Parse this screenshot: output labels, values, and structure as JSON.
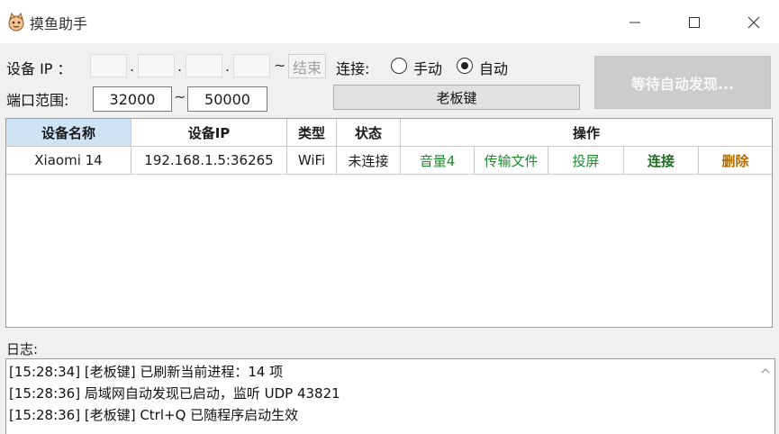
{
  "window": {
    "title": "摸鱼助手"
  },
  "controls": {
    "device_ip_label": "设备 IP ：",
    "ip_dots": [
      ".",
      ".",
      "."
    ],
    "tilde": "~",
    "end_button": "结束",
    "connect_label": "连接:",
    "manual_label": "手动",
    "auto_label": "自动",
    "mode_selected": "自动",
    "port_range_label": "端口范围:",
    "port_start": "32000",
    "port_end": "50000",
    "boss_key_button": "老板键",
    "wait_button": "等待自动发现..."
  },
  "table": {
    "headers": [
      "设备名称",
      "设备IP",
      "类型",
      "状态",
      "操作"
    ],
    "rows": [
      {
        "name": "Xiaomi 14",
        "ip": "192.168.1.5:36265",
        "type": "WiFi",
        "status": "未连接",
        "actions": [
          "音量4",
          "传输文件",
          "投屏",
          "连接",
          "删除"
        ]
      }
    ]
  },
  "log": {
    "label": "日志:",
    "lines": [
      "[15:28:34] [老板键] 已刷新当前进程：14 项",
      "[15:28:36] 局域网自动发现已启动，监听 UDP 43821",
      "[15:28:36] [老板键] Ctrl+Q 已随程序启动生效"
    ]
  },
  "icons": {
    "app": "fish-cat-icon",
    "minimize": "minimize-icon",
    "maximize": "maximize-icon",
    "close": "close-icon",
    "scroll": "scroll-up-arrow-icon"
  },
  "colors": {
    "header_highlight": "#cfe3f7",
    "action_green": "#1e8a2e",
    "connect_green": "#1e6b1e",
    "delete_orange": "#b36b00",
    "disabled_button": "#cccccc"
  }
}
